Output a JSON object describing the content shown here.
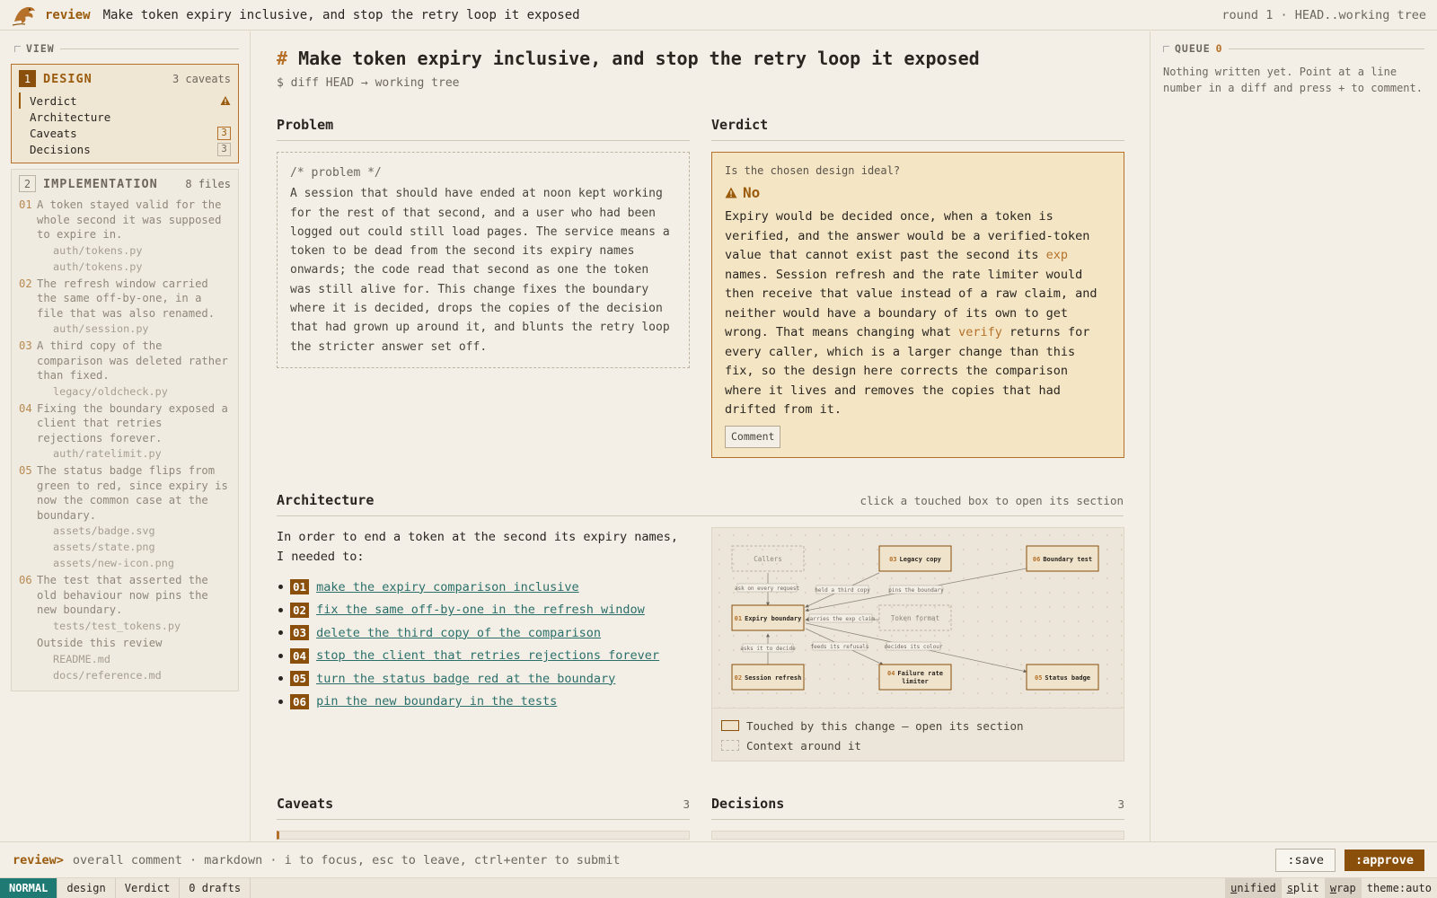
{
  "header": {
    "app_name": "review",
    "title": "Make token expiry inclusive, and stop the retry loop it exposed",
    "round": "round 1 · HEAD..working tree"
  },
  "sidebar": {
    "view_label": "VIEW",
    "design": {
      "num": "1",
      "label": "DESIGN",
      "meta": "3 caveats",
      "items": [
        {
          "label": "Verdict"
        },
        {
          "label": "Architecture"
        },
        {
          "label": "Caveats",
          "count": "3"
        },
        {
          "label": "Decisions",
          "count": "3"
        }
      ]
    },
    "implementation": {
      "num": "2",
      "label": "IMPLEMENTATION",
      "meta": "8 files",
      "items": [
        {
          "n": "01",
          "text": "A token stayed valid for the whole second it was supposed to expire in.",
          "files": [
            "auth/tokens.py",
            "auth/tokens.py"
          ]
        },
        {
          "n": "02",
          "text": "The refresh window carried the same off-by-one, in a file that was also renamed.",
          "files": [
            "auth/session.py"
          ]
        },
        {
          "n": "03",
          "text": "A third copy of the comparison was deleted rather than fixed.",
          "files": [
            "legacy/oldcheck.py"
          ]
        },
        {
          "n": "04",
          "text": "Fixing the boundary exposed a client that retries rejections forever.",
          "files": [
            "auth/ratelimit.py"
          ]
        },
        {
          "n": "05",
          "text": "The status badge flips from green to red, since expiry is now the common case at the boundary.",
          "files": [
            "assets/badge.svg",
            "assets/state.png",
            "assets/new-icon.png"
          ]
        },
        {
          "n": "06",
          "text": "The test that asserted the old behaviour now pins the new boundary.",
          "files": [
            "tests/test_tokens.py"
          ]
        }
      ],
      "outside_label": "Outside this review",
      "outside_files": [
        "README.md",
        "docs/reference.md"
      ]
    }
  },
  "main": {
    "title_hash": "#",
    "title": "Make token expiry inclusive, and stop the retry loop it exposed",
    "subtitle": "$ diff HEAD → working tree",
    "problem": {
      "heading": "Problem",
      "comment": "/* problem */",
      "text": "A session that should have ended at noon kept working for the rest of that second, and a user who had been logged out could still load pages. The service means a token to be dead from the second its expiry names onwards; the code read that second as one the token was still alive for. This change fixes the boundary where it is decided, drops the copies of the decision that had grown up around it, and blunts the retry loop the stricter answer set off."
    },
    "verdict": {
      "heading": "Verdict",
      "question": "Is the chosen design ideal?",
      "answer": "No",
      "body_1": "Expiry would be decided once, when a token is verified, and the answer would be a verified-token value that cannot exist past the second its ",
      "hl_1": "exp",
      "body_2": " names. Session refresh and the rate limiter would then receive that value instead of a raw claim, and neither would have a boundary of its own to get wrong. That means changing what ",
      "hl_2": "verify",
      "body_3": " returns for every caller, which is a larger change than this fix, so the design here corrects the comparison where it lives and removes the copies that had drifted from it.",
      "comment_button": "Comment"
    },
    "architecture": {
      "heading": "Architecture",
      "aside": "click a touched box to open its section",
      "intro": "In order to end a token at the second its expiry names, I needed to:",
      "steps": [
        {
          "n": "01",
          "text": "make the expiry comparison inclusive"
        },
        {
          "n": "02",
          "text": "fix the same off-by-one in the refresh window"
        },
        {
          "n": "03",
          "text": "delete the third copy of the comparison"
        },
        {
          "n": "04",
          "text": "stop the client that retries rejections forever"
        },
        {
          "n": "05",
          "text": "turn the status badge red at the boundary"
        },
        {
          "n": "06",
          "text": "pin the new boundary in the tests"
        }
      ],
      "diagram": {
        "nodes": {
          "callers": "Callers",
          "legacy": {
            "n": "03",
            "label": "Legacy copy"
          },
          "btest": {
            "n": "06",
            "label": "Boundary test"
          },
          "expiry": {
            "n": "01",
            "label": "Expiry boundary"
          },
          "token": "Token format",
          "session": {
            "n": "02",
            "label": "Session refresh"
          },
          "frl": {
            "n": "04",
            "label": "Failure rate",
            "label2": "limiter"
          },
          "badge": {
            "n": "05",
            "label": "Status badge"
          }
        },
        "edges": {
          "ask": "ask on every request",
          "held": "held a third copy",
          "pins": "pins the boundary",
          "carries": "carries the exp claim",
          "asks": "asks it to decide",
          "feeds": "feeds its refusals",
          "decides": "decides its colour"
        }
      },
      "legend": {
        "touched": "Touched by this change — open its section",
        "context": "Context around it"
      }
    },
    "caveats": {
      "heading": "Caveats",
      "count": "3"
    },
    "decisions": {
      "heading": "Decisions",
      "count": "3"
    }
  },
  "queue": {
    "label": "QUEUE",
    "count": "0",
    "note": "Nothing written yet. Point at a line number in a diff and press + to comment."
  },
  "command": {
    "prompt": "review>",
    "hint": "overall comment · markdown · i to focus, esc to leave, ctrl+enter to submit",
    "save": ":save",
    "approve": ":approve"
  },
  "status": {
    "mode": "NORMAL",
    "view": "design",
    "section": "Verdict",
    "drafts": "0 drafts",
    "unified_u": "u",
    "unified_rest": "nified",
    "split_s": "s",
    "split_rest": "plit",
    "wrap_w": "w",
    "wrap_rest": "rap",
    "theme": "theme:auto"
  },
  "colors": {
    "accent": "#9a5b0c",
    "accent_fill": "#8a4f0a",
    "verdict_bg": "#f4e6c4",
    "link": "#2a6f6a",
    "mode_bg": "#1f7a73"
  }
}
